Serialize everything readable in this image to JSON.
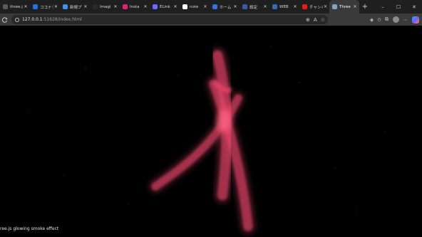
{
  "tabs": [
    {
      "label": "three.j",
      "icon": "globe-icon",
      "color": "#5a5a5a",
      "active": false
    },
    {
      "label": "ココナラ",
      "icon": "search-icon",
      "color": "#2b6fd6",
      "active": false
    },
    {
      "label": "新規プ",
      "icon": "app-icon",
      "color": "#4a8fe0",
      "active": false
    },
    {
      "label": "Imagi",
      "icon": "github-icon",
      "color": "#2a2a2a",
      "active": false
    },
    {
      "label": "Insta",
      "icon": "instagram-icon",
      "color": "#d6287a",
      "active": false
    },
    {
      "label": "ELink",
      "icon": "app-icon",
      "color": "#6c6cf0",
      "active": false
    },
    {
      "label": "note",
      "icon": "note-icon",
      "color": "#ffffff",
      "active": false
    },
    {
      "label": "ホーム",
      "icon": "globe-icon",
      "color": "#3b6fd0",
      "active": false
    },
    {
      "label": "設定",
      "icon": "app-icon",
      "color": "#3d5a9e",
      "active": false
    },
    {
      "label": "WEB",
      "icon": "globe-icon",
      "color": "#3a6aa8",
      "active": false
    },
    {
      "label": "チャンネ",
      "icon": "youtube-icon",
      "color": "#e02020",
      "active": false
    },
    {
      "label": "Three",
      "icon": "globe-icon",
      "color": "#8aa0c0",
      "active": true
    }
  ],
  "window_controls": {
    "minimize": "–",
    "maximize": "☐",
    "close": "✕"
  },
  "url": {
    "host": "127.0.0.1",
    "rest": ":51628/index.html"
  },
  "page": {
    "caption": "ree.js glowing smoke effect"
  },
  "colors": {
    "smoke": "#e8476a",
    "smoke_core": "#ff6a8a",
    "background": "#000000"
  }
}
